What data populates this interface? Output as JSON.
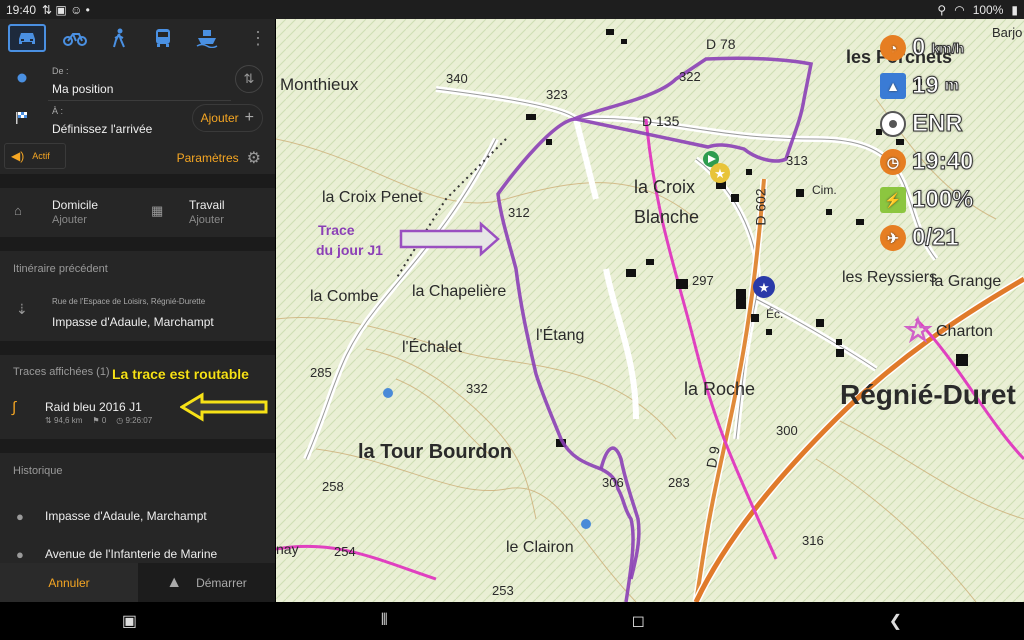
{
  "status": {
    "time": "19:40",
    "battery": "100%"
  },
  "modes": [
    "car-icon",
    "bike-icon",
    "walk-icon",
    "bus-icon",
    "boat-icon"
  ],
  "route": {
    "from_label": "De :",
    "from_value": "Ma position",
    "to_label": "À :",
    "to_value": "Définissez l'arrivée",
    "add_label": "Ajouter"
  },
  "active_label": "Actif",
  "params_label": "Paramètres",
  "favorites": [
    {
      "title": "Domicile",
      "sub": "Ajouter"
    },
    {
      "title": "Travail",
      "sub": "Ajouter"
    }
  ],
  "previous_title": "Itinéraire précédent",
  "previous": {
    "address": "Rue de l'Espace de Loisirs, Régnié-Durette",
    "name": "Impasse d'Adaule, Marchampt"
  },
  "tracks_title": "Traces affichées (1)",
  "track": {
    "name": "Raid bleu 2016 J1",
    "distance": "94,6 km",
    "flags": "0",
    "duration": "9:26:07"
  },
  "history_title": "Historique",
  "history": [
    "Impasse d'Adaule, Marchampt",
    "Avenue de l'Infanterie de Marine"
  ],
  "cancel_label": "Annuler",
  "start_label": "Démarrer",
  "callout_routable": "La trace est routable",
  "callout_trace_1": "Trace",
  "callout_trace_2": "du jour J1",
  "hud": {
    "speed": "0",
    "speed_unit": "km/h",
    "altitude": "19",
    "altitude_unit": "m",
    "rec": "ENR",
    "clock": "19:40",
    "battery": "100%",
    "count": "0/21"
  },
  "map_labels": [
    "Monthieux",
    "les Forchets",
    "la Croix Penet",
    "la Croix",
    "Blanche",
    "les Reyssiers",
    "la Grange",
    "Charton",
    "la Combe",
    "la Chapelière",
    "l'Étang",
    "l'Échalet",
    "la Roche",
    "Régnié-Duret",
    "la Tour Bourdon",
    "le Clairon",
    "Cim.",
    "Éc.",
    "D 78",
    "D 135",
    "D 602",
    "D 9",
    "340",
    "323",
    "322",
    "313",
    "312",
    "297",
    "285",
    "332",
    "306",
    "283",
    "300",
    "258",
    "254",
    "253",
    "316",
    "Barjo",
    "nay"
  ]
}
